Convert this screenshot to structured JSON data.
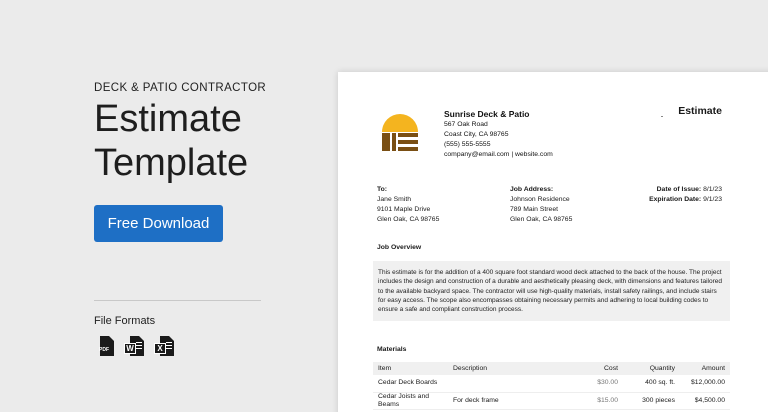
{
  "promo": {
    "eyebrow": "DECK & PATIO CONTRACTOR",
    "title_line1": "Estimate",
    "title_line2": "Template",
    "cta_label": "Free Download",
    "formats_label": "File Formats",
    "formats": [
      {
        "name": "pdf-file-icon",
        "badge": "PDF"
      },
      {
        "name": "word-file-icon",
        "badge": "W"
      },
      {
        "name": "excel-file-icon",
        "badge": "X"
      }
    ]
  },
  "colors": {
    "cta": "#1e6fc5",
    "logo_sun": "#f4b41f",
    "logo_brown": "#7a4f14"
  },
  "document": {
    "title": "Estimate",
    "company": {
      "name": "Sunrise Deck & Patio",
      "address1": "567 Oak Road",
      "address2": "Coast City, CA 98765",
      "phone": "(555) 555-5555",
      "contact": "company@email.com | website.com"
    },
    "to": {
      "label": "To:",
      "name": "Jane Smith",
      "street": "9101 Maple Drive",
      "city": "Glen Oak, CA 98765"
    },
    "job_address": {
      "label": "Job Address:",
      "name": "Johnson Residence",
      "street": "789 Main Street",
      "city": "Glen Oak, CA 98765"
    },
    "dates": {
      "issue_label": "Date of Issue:",
      "issue_value": "8/1/23",
      "expiration_label": "Expiration Date:",
      "expiration_value": "9/1/23"
    },
    "overview_heading": "Job Overview",
    "overview_text": "This estimate is for the addition of a 400 square foot standard wood deck attached to the back of the house. The project includes the design and construction of a durable and aesthetically pleasing deck, with dimensions and features tailored to the available backyard space. The contractor will use high-quality materials, install safety railings, and include stairs for easy access. The scope also encompasses obtaining necessary permits and adhering to local building codes to ensure a safe and compliant construction process.",
    "materials_heading": "Materials",
    "materials_columns": {
      "item": "Item",
      "description": "Description",
      "cost": "Cost",
      "quantity": "Quantity",
      "amount": "Amount"
    },
    "materials_rows": [
      {
        "item": "Cedar Deck Boards",
        "description": "",
        "cost": "$30.00",
        "quantity": "400 sq. ft.",
        "amount": "$12,000.00"
      },
      {
        "item": "Cedar Joists and Beams",
        "description": "For deck frame",
        "cost": "$15.00",
        "quantity": "300 pieces",
        "amount": "$4,500.00"
      }
    ]
  }
}
